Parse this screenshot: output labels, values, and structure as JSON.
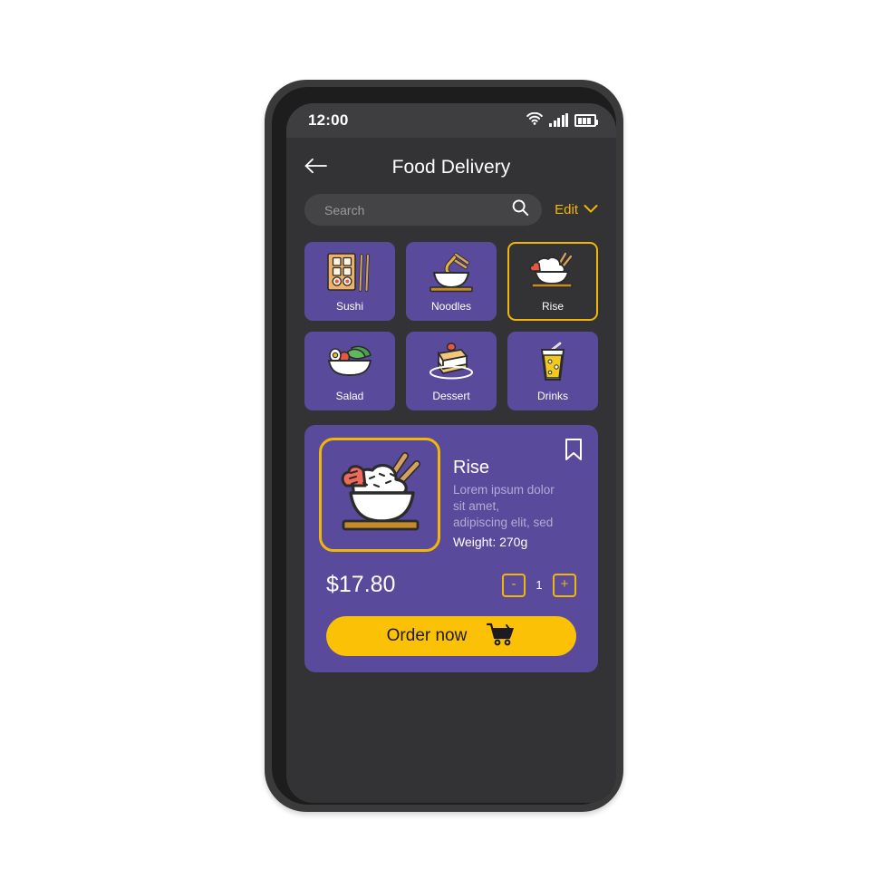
{
  "status_bar": {
    "time": "12:00",
    "icons": [
      "wifi-icon",
      "signal-icon",
      "battery-icon"
    ]
  },
  "header": {
    "back_icon": "arrow-left-icon",
    "title": "Food Delivery"
  },
  "search": {
    "placeholder": "Search",
    "value": "",
    "icon": "search-icon",
    "edit_label": "Edit",
    "edit_icon": "chevron-down-icon"
  },
  "categories": [
    {
      "label": "Sushi",
      "icon": "sushi-icon",
      "selected": false
    },
    {
      "label": "Noodles",
      "icon": "noodles-icon",
      "selected": false
    },
    {
      "label": "Rise",
      "icon": "rice-icon",
      "selected": true
    },
    {
      "label": "Salad",
      "icon": "salad-icon",
      "selected": false
    },
    {
      "label": "Dessert",
      "icon": "dessert-icon",
      "selected": false
    },
    {
      "label": "Drinks",
      "icon": "drink-icon",
      "selected": false
    }
  ],
  "product": {
    "name": "Rise",
    "description": "Lorem ipsum dolor\nsit amet,\nadipiscing elit, sed",
    "weight": "Weight: 270g",
    "price": "$17.80",
    "image_icon": "rice-bowl-icon",
    "bookmark_icon": "bookmark-icon",
    "quantity": "1",
    "decrement_label": "-",
    "increment_label": "+",
    "order_label": "Order now",
    "order_icon": "shopping-cart-icon"
  },
  "colors": {
    "accent_yellow": "#f2b705",
    "button_yellow": "#fbc107",
    "card_purple": "#5a4a9c",
    "screen_dark": "#333335",
    "status_bar_dark": "#3e3e40",
    "frame_dark": "#1d1d1d",
    "text_muted": "#b4abd2"
  }
}
